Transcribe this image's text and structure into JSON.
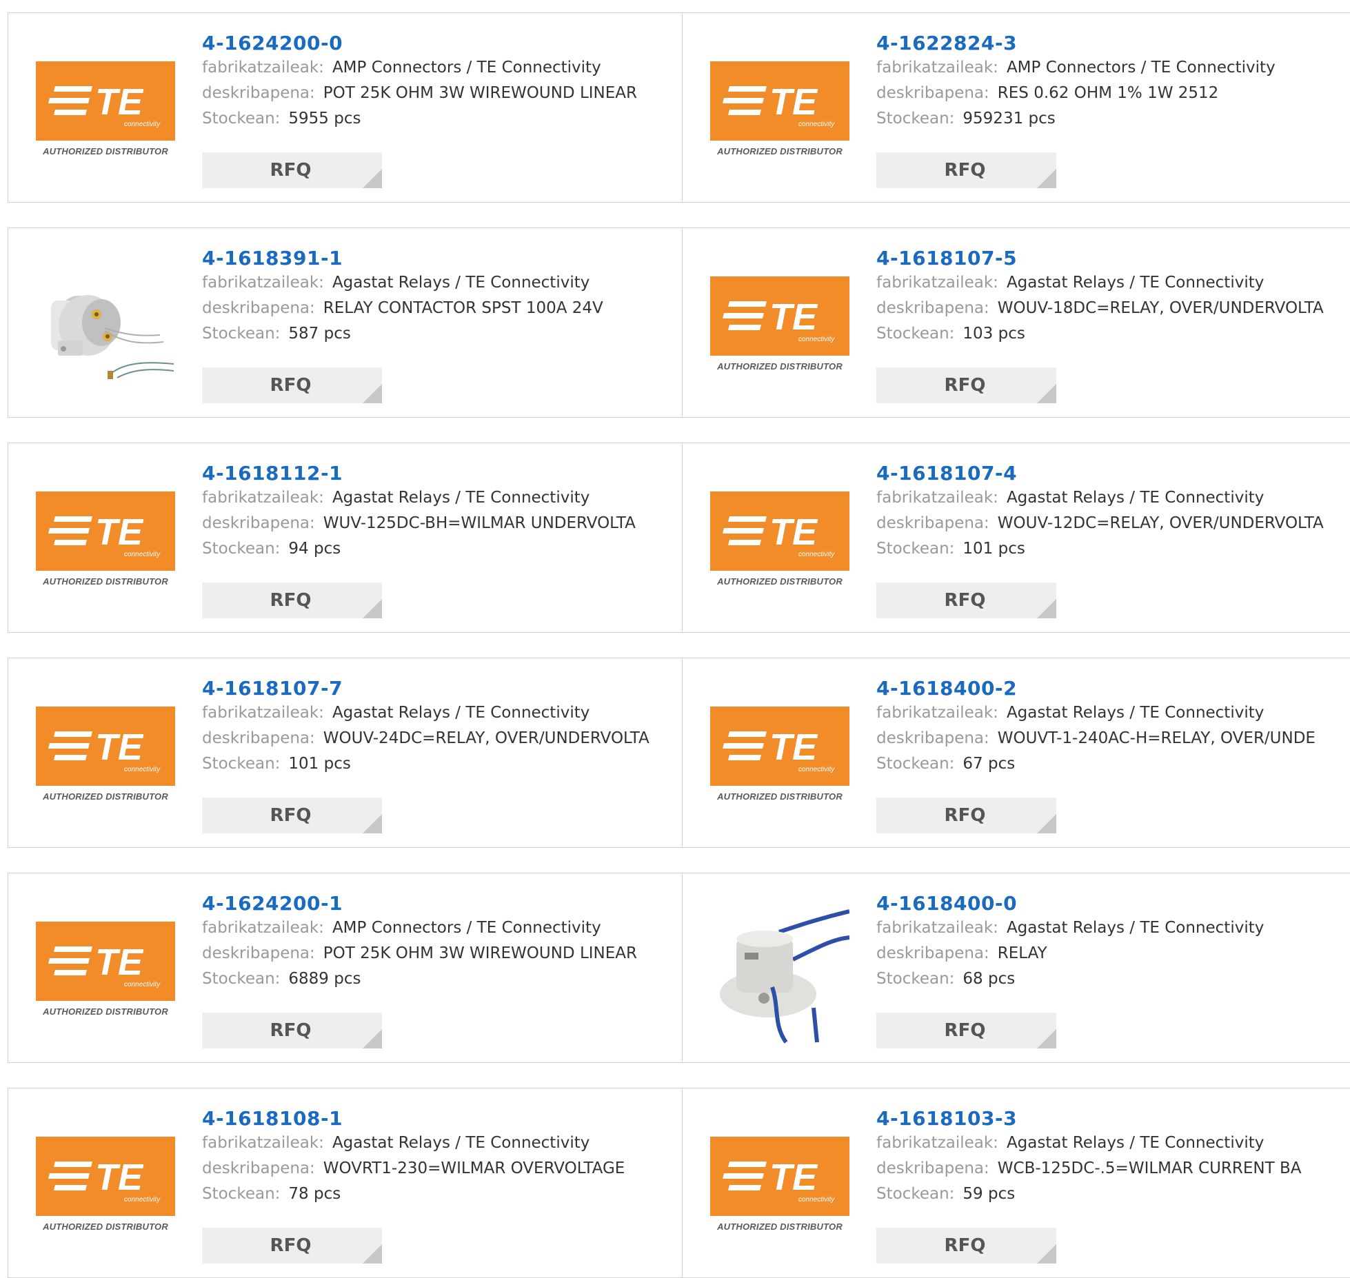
{
  "labels": {
    "manufacturer": "fabrikatzaileak:",
    "description": "deskribapena:",
    "stock": "Stockean:",
    "rfq": "RFQ"
  },
  "logo": {
    "text": "TE",
    "subtext": "connectivity",
    "authorized": "AUTHORIZED DISTRIBUTOR",
    "color": "#f28c28"
  },
  "colors": {
    "link": "#1a6bbf",
    "label": "#999999",
    "value": "#333333",
    "button_bg": "#eeeeee"
  },
  "products": [
    {
      "pn": "4-1624200-0",
      "manufacturer": "AMP Connectors / TE Connectivity",
      "description": "POT 25K OHM 3W WIREWOUND LINEAR",
      "stock": "5955 pcs",
      "image": "te-logo"
    },
    {
      "pn": "4-1622824-3",
      "manufacturer": "AMP Connectors / TE Connectivity",
      "description": "RES 0.62 OHM 1% 1W 2512",
      "stock": "959231 pcs",
      "image": "te-logo"
    },
    {
      "pn": "4-1618391-1",
      "manufacturer": "Agastat Relays / TE Connectivity",
      "description": "RELAY CONTACTOR SPST 100A 24V",
      "stock": "587 pcs",
      "image": "relay-contactor-photo"
    },
    {
      "pn": "4-1618107-5",
      "manufacturer": "Agastat Relays / TE Connectivity",
      "description": "WOUV-18DC=RELAY, OVER/UNDERVOLTA",
      "stock": "103 pcs",
      "image": "te-logo"
    },
    {
      "pn": "4-1618112-1",
      "manufacturer": "Agastat Relays / TE Connectivity",
      "description": "WUV-125DC-BH=WILMAR UNDERVOLTA",
      "stock": "94 pcs",
      "image": "te-logo"
    },
    {
      "pn": "4-1618107-4",
      "manufacturer": "Agastat Relays / TE Connectivity",
      "description": "WOUV-12DC=RELAY, OVER/UNDERVOLTA",
      "stock": "101 pcs",
      "image": "te-logo"
    },
    {
      "pn": "4-1618107-7",
      "manufacturer": "Agastat Relays / TE Connectivity",
      "description": "WOUV-24DC=RELAY, OVER/UNDERVOLTA",
      "stock": "101 pcs",
      "image": "te-logo"
    },
    {
      "pn": "4-1618400-2",
      "manufacturer": "Agastat Relays / TE Connectivity",
      "description": "WOUVT-1-240AC-H=RELAY, OVER/UNDE",
      "stock": "67 pcs",
      "image": "te-logo"
    },
    {
      "pn": "4-1624200-1",
      "manufacturer": "AMP Connectors / TE Connectivity",
      "description": "POT 25K OHM 3W WIREWOUND LINEAR",
      "stock": "6889 pcs",
      "image": "te-logo"
    },
    {
      "pn": "4-1618400-0",
      "manufacturer": "Agastat Relays / TE Connectivity",
      "description": "RELAY",
      "stock": "68 pcs",
      "image": "relay-sensor-photo"
    },
    {
      "pn": "4-1618108-1",
      "manufacturer": "Agastat Relays / TE Connectivity",
      "description": "WOVRT1-230=WILMAR OVERVOLTAGE",
      "stock": "78 pcs",
      "image": "te-logo"
    },
    {
      "pn": "4-1618103-3",
      "manufacturer": "Agastat Relays / TE Connectivity",
      "description": "WCB-125DC-.5=WILMAR CURRENT BA",
      "stock": "59 pcs",
      "image": "te-logo"
    }
  ]
}
